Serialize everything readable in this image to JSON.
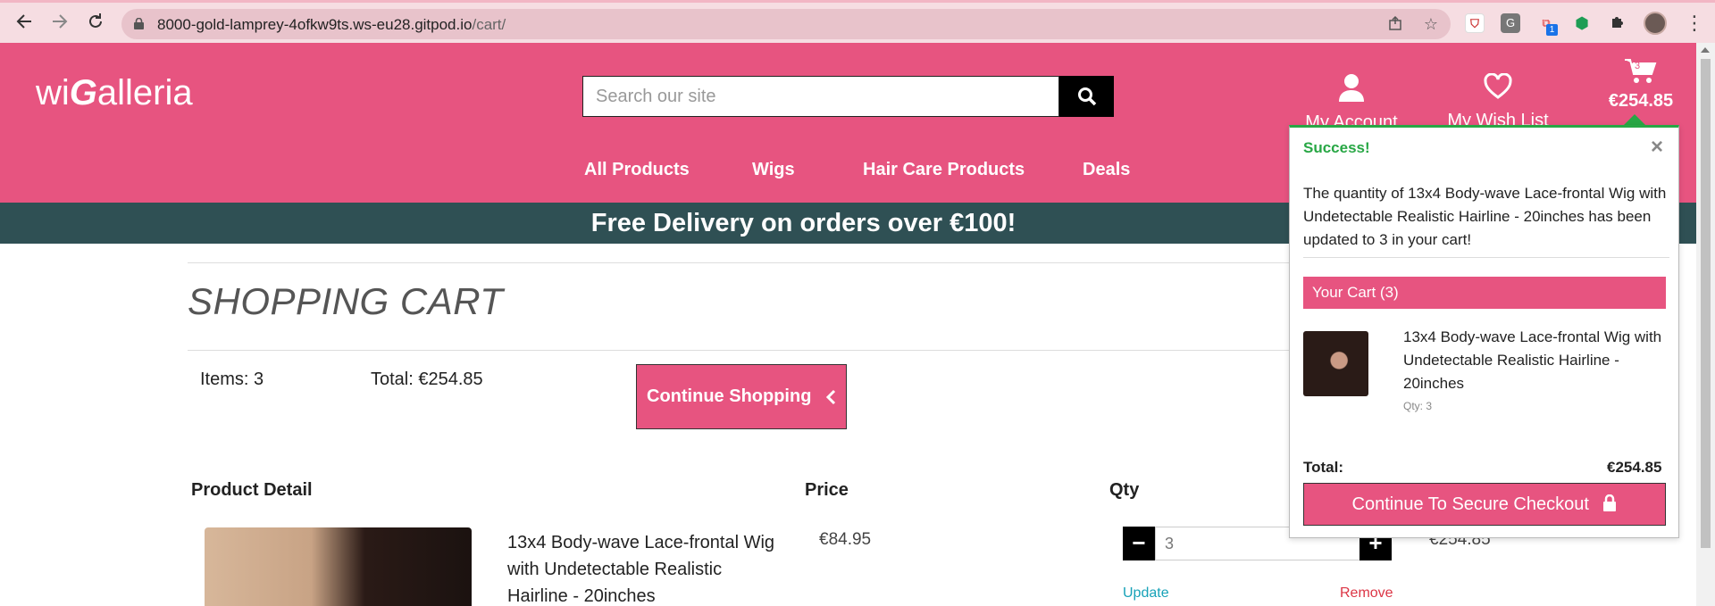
{
  "browser": {
    "url_host": "8000-gold-lamprey-4ofkw9ts.ws-eu28.gitpod.io",
    "url_path": "/cart/",
    "extension_badge": "1",
    "icons": [
      "back-arrow-icon",
      "forward-arrow-icon",
      "reload-icon",
      "lock-icon",
      "share-icon",
      "star-icon",
      "extensions-puzzle-icon",
      "kebab-menu-icon"
    ]
  },
  "header": {
    "logo_prefix": "wi",
    "logo_g": "G",
    "logo_suffix": "alleria",
    "search_placeholder": "Search our site",
    "account_label": "My Account",
    "wishlist_label": "My Wish List",
    "cart_count": "3",
    "cart_total": "€254.85",
    "brand_color": "#e75480",
    "banner_color": "#2f5054"
  },
  "nav": {
    "items": [
      "All Products",
      "Wigs",
      "Hair Care Products",
      "Deals"
    ]
  },
  "banner": {
    "text": "Free Delivery on orders over €100!"
  },
  "cart": {
    "title": "SHOPPING CART",
    "items_text": "Items: 3",
    "total_text": "Total: €254.85",
    "continue_label": "Continue Shopping",
    "columns": [
      "Product Detail",
      "Price",
      "Qty"
    ],
    "rows": [
      {
        "name": "13x4 Body-wave Lace-frontal Wig with Undetectable Realistic Hairline - 20inches",
        "price": "€84.95",
        "qty": "3",
        "subtotal": "€254.85",
        "update_label": "Update",
        "remove_label": "Remove"
      }
    ]
  },
  "popover": {
    "status": "Success!",
    "close": "×",
    "message": "The quantity of 13x4 Body-wave Lace-frontal Wig with Undetectable Realistic Hairline - 20inches has been updated to 3 in your cart!",
    "cart_header": "Your Cart (3)",
    "item_name": "13x4 Body-wave Lace-frontal Wig with Undetectable Realistic Hairline - 20inches",
    "item_qty": "Qty: 3",
    "total_label": "Total:",
    "total_value": "€254.85",
    "checkout_label": "Continue To Secure Checkout",
    "success_color": "#28a745"
  }
}
